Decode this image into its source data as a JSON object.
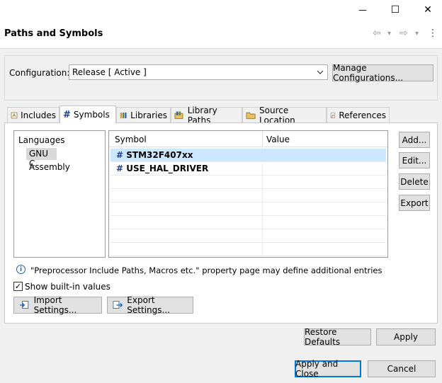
{
  "window": {
    "minimize_glyph": "—",
    "maximize_glyph": "☐",
    "close_glyph": "✕"
  },
  "header": {
    "title": "Paths and Symbols",
    "nav": {
      "back_glyph": "⇦",
      "dropdown_glyph": "▾",
      "forward_glyph": "⇨",
      "menu_glyph": "⋮"
    }
  },
  "configuration": {
    "label": "Configuration:",
    "selected": "Release  [ Active ]",
    "manage_button": "Manage Configurations..."
  },
  "tabs": [
    {
      "label": "Includes",
      "icon": "includes-icon",
      "active": false
    },
    {
      "label": "Symbols",
      "icon": "hash-icon",
      "active": true
    },
    {
      "label": "Libraries",
      "icon": "libraries-icon",
      "active": false
    },
    {
      "label": "Library Paths",
      "icon": "library-paths-icon",
      "active": false
    },
    {
      "label": "Source Location",
      "icon": "folder-icon",
      "active": false
    },
    {
      "label": "References",
      "icon": "references-icon",
      "active": false
    }
  ],
  "languages": {
    "header": "Languages",
    "items": [
      {
        "label": "GNU C",
        "selected": true
      },
      {
        "label": "Assembly",
        "selected": false
      }
    ]
  },
  "symbols_table": {
    "columns": [
      "Symbol",
      "Value"
    ],
    "rows": [
      {
        "symbol": "STM32F407xx",
        "value": "",
        "selected": true
      },
      {
        "symbol": "USE_HAL_DRIVER",
        "value": "",
        "selected": false
      }
    ],
    "hash_glyph": "#"
  },
  "side_buttons": {
    "add": "Add...",
    "edit": "Edit...",
    "delete": "Delete",
    "export": "Export"
  },
  "info": {
    "glyph": "i",
    "text": "\"Preprocessor Include Paths, Macros etc.\" property page may define additional entries"
  },
  "show_builtin": {
    "label": "Show built-in values",
    "checked": true,
    "check_glyph": "✓"
  },
  "settings_buttons": {
    "import": "Import Settings...",
    "export": "Export Settings..."
  },
  "footer": {
    "restore_defaults": "Restore Defaults",
    "apply": "Apply",
    "apply_and_close": "Apply and Close",
    "cancel": "Cancel"
  },
  "colors": {
    "selection": "#cce8ff",
    "accent": "#0078d7"
  }
}
